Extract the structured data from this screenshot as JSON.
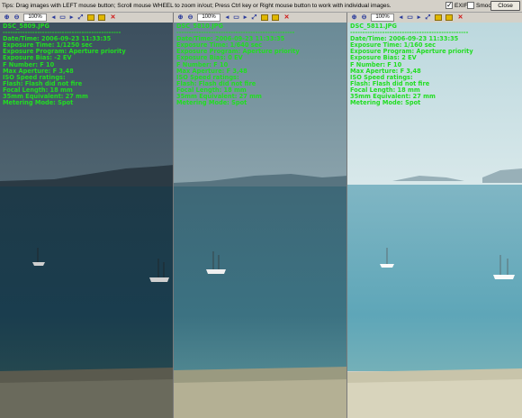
{
  "header": {
    "tips": "Tips: Drag images with LEFT mouse button; Scroll mouse WHEEL to zoom in/out; Press Ctrl key or Right mouse button to work with individual images.",
    "exif_label": "EXIF",
    "exif_checked": true,
    "smooth_label": "Smooth",
    "smooth_checked": false,
    "close_label": "Close"
  },
  "panels": [
    {
      "zoom": "100%",
      "filename": "DSC_5809.JPG",
      "separator": "------------------------------------------------",
      "lines": [
        "Date/Time: 2006-09-23 11:33:35",
        "Exposure Time: 1/1250 sec",
        "Exposure Program: Aperture priority",
        "Exposure Bias: -2 EV",
        "F Number: F 10",
        "Max Aperture: F 3,48",
        "ISO Speed ratings:",
        "Flash: Flash did not fire",
        "Focal Length: 18 mm",
        "35mm Equivalent: 27 mm",
        "Metering Mode: Spot"
      ],
      "tone": "dark"
    },
    {
      "zoom": "100%",
      "filename": "DSC_5810.JPG",
      "separator": "------------------------------------------------",
      "lines": [
        "Date/Time: 2006-09-23 11:33:35",
        "Exposure Time: 1/640 sec",
        "Exposure Program: Aperture priority",
        "Exposure Bias: 0 EV",
        "F Number: F 10",
        "Max Aperture: F 3,48",
        "ISO Speed ratings:",
        "Flash: Flash did not fire",
        "Focal Length: 18 mm",
        "35mm Equivalent: 27 mm",
        "Metering Mode: Spot"
      ],
      "tone": "mid"
    },
    {
      "zoom": "100%",
      "filename": "DSC_5811.JPG",
      "separator": "------------------------------------------------",
      "lines": [
        "Date/Time: 2006-09-23 11:33:35",
        "Exposure Time: 1/160 sec",
        "Exposure Program: Aperture priority",
        "Exposure Bias: 2 EV",
        "F Number: F 10",
        "Max Aperture: F 3,48",
        "ISO Speed ratings:",
        "Flash: Flash did not fire",
        "Focal Length: 18 mm",
        "35mm Equivalent: 27 mm",
        "Metering Mode: Spot"
      ],
      "tone": "light"
    }
  ],
  "colors": {
    "exif_text": "#22dd22",
    "close_icon": "#d01010",
    "toolbar_icon": "#2a3a9a",
    "folder_icon": "#e0b800"
  },
  "icons": {
    "zoom_in": "zoom-in-icon",
    "zoom_out": "zoom-out-icon",
    "prev": "arrow-left-icon",
    "fit": "fit-window-icon",
    "next": "arrow-right-icon",
    "actual_size": "actual-size-icon",
    "open": "open-folder-icon",
    "save": "save-folder-icon",
    "close": "close-icon"
  }
}
